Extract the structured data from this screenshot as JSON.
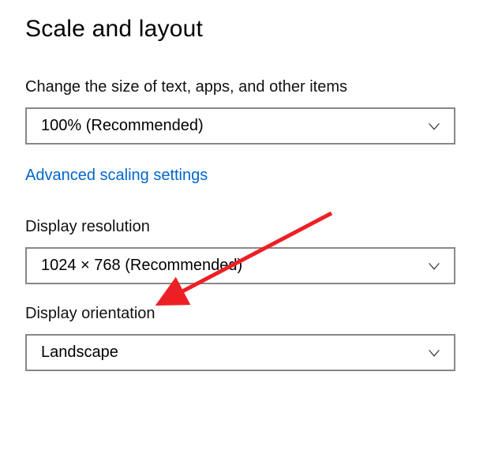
{
  "heading": "Scale and layout",
  "scale": {
    "label": "Change the size of text, apps, and other items",
    "selected": "100% (Recommended)"
  },
  "link": {
    "advanced_scaling": "Advanced scaling settings"
  },
  "resolution": {
    "label": "Display resolution",
    "selected": "1024 × 768 (Recommended)"
  },
  "orientation": {
    "label": "Display orientation",
    "selected": "Landscape"
  },
  "colors": {
    "link_color": "#0066cc",
    "arrow_color": "#ec2024"
  }
}
